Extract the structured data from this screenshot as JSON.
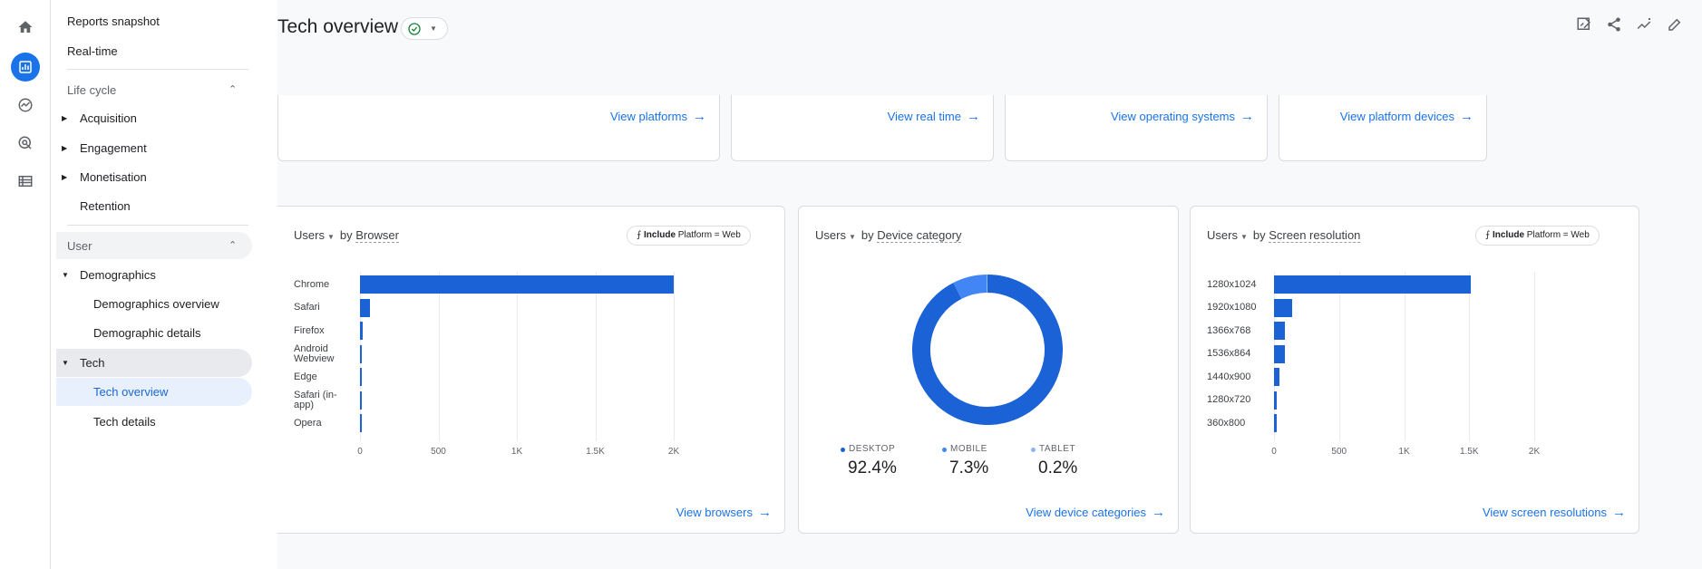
{
  "nav": {
    "reports_snapshot": "Reports snapshot",
    "realtime": "Real-time",
    "lifecycle": "Life cycle",
    "acquisition": "Acquisition",
    "engagement": "Engagement",
    "monetisation": "Monetisation",
    "retention": "Retention",
    "user": "User",
    "demographics": "Demographics",
    "demographics_overview": "Demographics overview",
    "demographic_details": "Demographic details",
    "tech": "Tech",
    "tech_overview": "Tech overview",
    "tech_details": "Tech details"
  },
  "header": {
    "title": "Tech overview"
  },
  "top_links": [
    "View platforms",
    "View real time",
    "View operating systems",
    "View platform devices"
  ],
  "cards": {
    "browser": {
      "metric": "Users",
      "by": "by",
      "dimension": "Browser",
      "filter_prefix": "Include",
      "filter_value": "Platform = Web",
      "link": "View browsers",
      "tick_labels": [
        "0",
        "500",
        "1K",
        "1.5K",
        "2K"
      ]
    },
    "device": {
      "metric": "Users",
      "by": "by",
      "dimension": "Device category",
      "link": "View device categories",
      "legend": [
        {
          "label": "DESKTOP",
          "value": "92.4%",
          "color": "#1a62d6"
        },
        {
          "label": "MOBILE",
          "value": "7.3%",
          "color": "#4285f4"
        },
        {
          "label": "TABLET",
          "value": "0.2%",
          "color": "#8ab4f8"
        }
      ]
    },
    "resolution": {
      "metric": "Users",
      "by": "by",
      "dimension": "Screen resolution",
      "filter_prefix": "Include",
      "filter_value": "Platform = Web",
      "link": "View screen resolutions",
      "tick_labels": [
        "0",
        "500",
        "1K",
        "1.5K",
        "2K"
      ]
    }
  },
  "chart_data": [
    {
      "type": "bar",
      "title": "Users by Browser",
      "categories": [
        "Chrome",
        "Safari",
        "Firefox",
        "Android Webview",
        "Edge",
        "Safari (in-app)",
        "Opera"
      ],
      "values": [
        2000,
        65,
        20,
        10,
        10,
        2,
        1
      ],
      "xlim": [
        0,
        2000
      ]
    },
    {
      "type": "pie",
      "title": "Users by Device category",
      "categories": [
        "DESKTOP",
        "MOBILE",
        "TABLET"
      ],
      "values": [
        92.4,
        7.3,
        0.2
      ]
    },
    {
      "type": "bar",
      "title": "Users by Screen resolution",
      "categories": [
        "1280x1024",
        "1920x1080",
        "1366x768",
        "1536x864",
        "1440x900",
        "1280x720",
        "360x800"
      ],
      "values": [
        1510,
        140,
        85,
        85,
        45,
        20,
        20
      ],
      "xlim": [
        0,
        2000
      ]
    }
  ],
  "colors": {
    "accent": "#1a73e8",
    "bar": "#1a62d6"
  }
}
